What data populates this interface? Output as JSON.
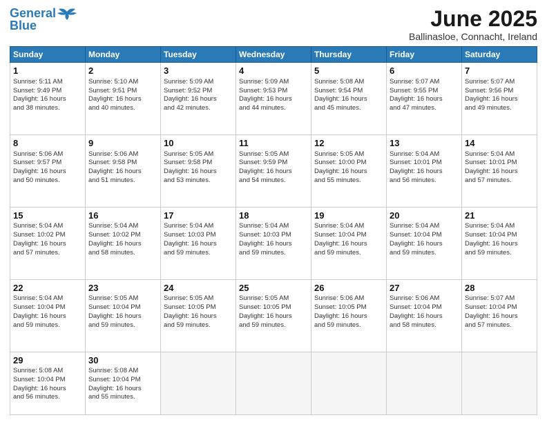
{
  "logo": {
    "line1": "General",
    "line2": "Blue"
  },
  "title": "June 2025",
  "location": "Ballinasloe, Connacht, Ireland",
  "headers": [
    "Sunday",
    "Monday",
    "Tuesday",
    "Wednesday",
    "Thursday",
    "Friday",
    "Saturday"
  ],
  "weeks": [
    [
      {
        "day": "1",
        "info": "Sunrise: 5:11 AM\nSunset: 9:49 PM\nDaylight: 16 hours\nand 38 minutes."
      },
      {
        "day": "2",
        "info": "Sunrise: 5:10 AM\nSunset: 9:51 PM\nDaylight: 16 hours\nand 40 minutes."
      },
      {
        "day": "3",
        "info": "Sunrise: 5:09 AM\nSunset: 9:52 PM\nDaylight: 16 hours\nand 42 minutes."
      },
      {
        "day": "4",
        "info": "Sunrise: 5:09 AM\nSunset: 9:53 PM\nDaylight: 16 hours\nand 44 minutes."
      },
      {
        "day": "5",
        "info": "Sunrise: 5:08 AM\nSunset: 9:54 PM\nDaylight: 16 hours\nand 45 minutes."
      },
      {
        "day": "6",
        "info": "Sunrise: 5:07 AM\nSunset: 9:55 PM\nDaylight: 16 hours\nand 47 minutes."
      },
      {
        "day": "7",
        "info": "Sunrise: 5:07 AM\nSunset: 9:56 PM\nDaylight: 16 hours\nand 49 minutes."
      }
    ],
    [
      {
        "day": "8",
        "info": "Sunrise: 5:06 AM\nSunset: 9:57 PM\nDaylight: 16 hours\nand 50 minutes."
      },
      {
        "day": "9",
        "info": "Sunrise: 5:06 AM\nSunset: 9:58 PM\nDaylight: 16 hours\nand 51 minutes."
      },
      {
        "day": "10",
        "info": "Sunrise: 5:05 AM\nSunset: 9:58 PM\nDaylight: 16 hours\nand 53 minutes."
      },
      {
        "day": "11",
        "info": "Sunrise: 5:05 AM\nSunset: 9:59 PM\nDaylight: 16 hours\nand 54 minutes."
      },
      {
        "day": "12",
        "info": "Sunrise: 5:05 AM\nSunset: 10:00 PM\nDaylight: 16 hours\nand 55 minutes."
      },
      {
        "day": "13",
        "info": "Sunrise: 5:04 AM\nSunset: 10:01 PM\nDaylight: 16 hours\nand 56 minutes."
      },
      {
        "day": "14",
        "info": "Sunrise: 5:04 AM\nSunset: 10:01 PM\nDaylight: 16 hours\nand 57 minutes."
      }
    ],
    [
      {
        "day": "15",
        "info": "Sunrise: 5:04 AM\nSunset: 10:02 PM\nDaylight: 16 hours\nand 57 minutes."
      },
      {
        "day": "16",
        "info": "Sunrise: 5:04 AM\nSunset: 10:02 PM\nDaylight: 16 hours\nand 58 minutes."
      },
      {
        "day": "17",
        "info": "Sunrise: 5:04 AM\nSunset: 10:03 PM\nDaylight: 16 hours\nand 59 minutes."
      },
      {
        "day": "18",
        "info": "Sunrise: 5:04 AM\nSunset: 10:03 PM\nDaylight: 16 hours\nand 59 minutes."
      },
      {
        "day": "19",
        "info": "Sunrise: 5:04 AM\nSunset: 10:04 PM\nDaylight: 16 hours\nand 59 minutes."
      },
      {
        "day": "20",
        "info": "Sunrise: 5:04 AM\nSunset: 10:04 PM\nDaylight: 16 hours\nand 59 minutes."
      },
      {
        "day": "21",
        "info": "Sunrise: 5:04 AM\nSunset: 10:04 PM\nDaylight: 16 hours\nand 59 minutes."
      }
    ],
    [
      {
        "day": "22",
        "info": "Sunrise: 5:04 AM\nSunset: 10:04 PM\nDaylight: 16 hours\nand 59 minutes."
      },
      {
        "day": "23",
        "info": "Sunrise: 5:05 AM\nSunset: 10:04 PM\nDaylight: 16 hours\nand 59 minutes."
      },
      {
        "day": "24",
        "info": "Sunrise: 5:05 AM\nSunset: 10:05 PM\nDaylight: 16 hours\nand 59 minutes."
      },
      {
        "day": "25",
        "info": "Sunrise: 5:05 AM\nSunset: 10:05 PM\nDaylight: 16 hours\nand 59 minutes."
      },
      {
        "day": "26",
        "info": "Sunrise: 5:06 AM\nSunset: 10:05 PM\nDaylight: 16 hours\nand 59 minutes."
      },
      {
        "day": "27",
        "info": "Sunrise: 5:06 AM\nSunset: 10:04 PM\nDaylight: 16 hours\nand 58 minutes."
      },
      {
        "day": "28",
        "info": "Sunrise: 5:07 AM\nSunset: 10:04 PM\nDaylight: 16 hours\nand 57 minutes."
      }
    ],
    [
      {
        "day": "29",
        "info": "Sunrise: 5:08 AM\nSunset: 10:04 PM\nDaylight: 16 hours\nand 56 minutes."
      },
      {
        "day": "30",
        "info": "Sunrise: 5:08 AM\nSunset: 10:04 PM\nDaylight: 16 hours\nand 55 minutes."
      },
      {
        "day": "",
        "info": ""
      },
      {
        "day": "",
        "info": ""
      },
      {
        "day": "",
        "info": ""
      },
      {
        "day": "",
        "info": ""
      },
      {
        "day": "",
        "info": ""
      }
    ]
  ]
}
